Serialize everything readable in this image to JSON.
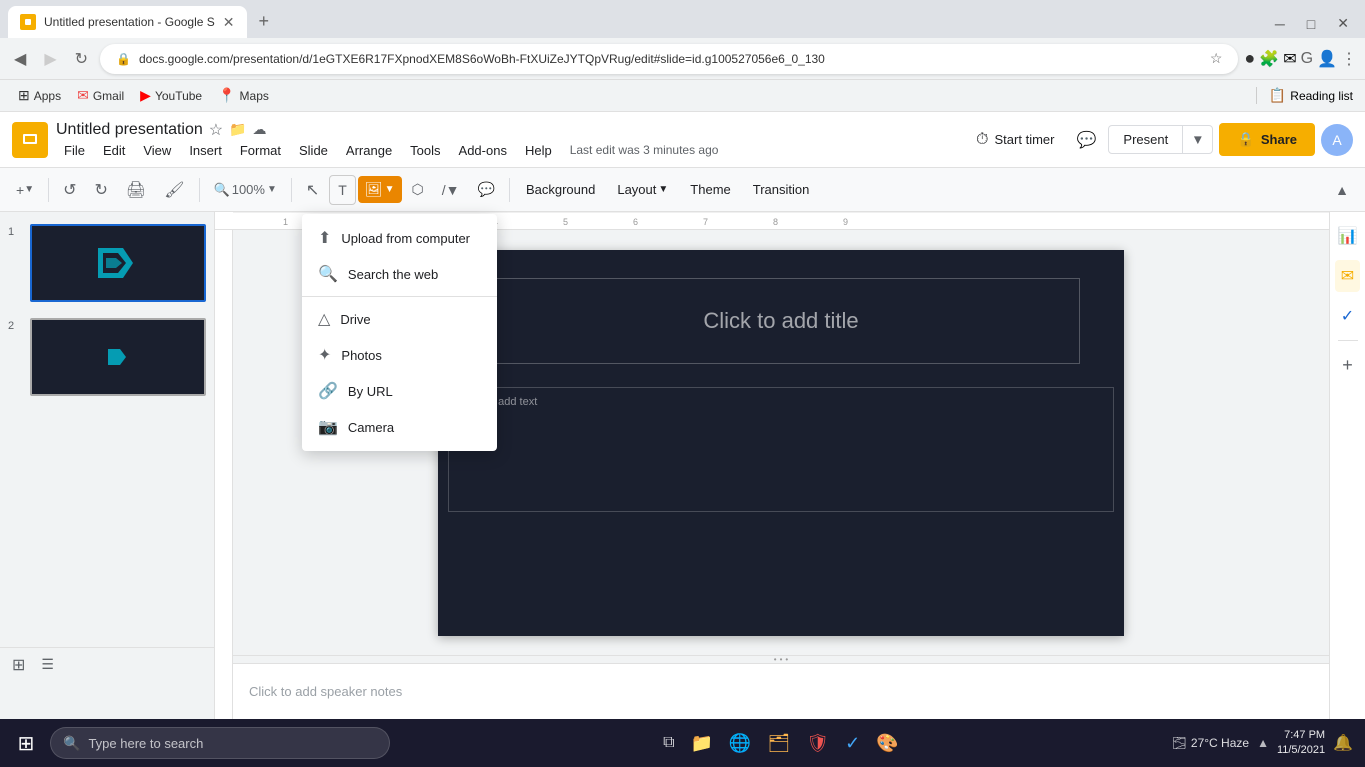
{
  "browser": {
    "tab_title": "Untitled presentation - Google S",
    "tab_favicon": "G",
    "address": "docs.google.com/presentation/d/1eGTXE6R17FXpnodXEM8S6oWoBh-FtXUiZeJYTQpVRug/edit#slide=id.g100527056e6_0_130",
    "new_tab_label": "+",
    "bookmarks": [
      {
        "label": "Apps",
        "icon": "grid"
      },
      {
        "label": "Gmail",
        "icon": "mail"
      },
      {
        "label": "YouTube",
        "icon": "youtube"
      },
      {
        "label": "Maps",
        "icon": "map"
      }
    ],
    "reading_list": "Reading list"
  },
  "app": {
    "logo_color": "#f6ae00",
    "title": "Untitled presentation",
    "star_icon": "★",
    "folder_icon": "📁",
    "cloud_icon": "☁",
    "menu": [
      "File",
      "Edit",
      "View",
      "Insert",
      "Format",
      "Slide",
      "Arrange",
      "Tools",
      "Add-ons",
      "Help"
    ],
    "last_edit": "Last edit was 3 minutes ago",
    "start_timer": "Start timer",
    "comment_icon": "💬",
    "present_btn": "Present",
    "share_btn": "Share"
  },
  "toolbar": {
    "undo_label": "↺",
    "redo_label": "↻",
    "print_label": "🖨",
    "paint_label": "🖌",
    "zoom_label": "100%",
    "cursor_label": "↖",
    "background_btn": "Background",
    "layout_btn": "Layout",
    "theme_btn": "Theme",
    "transition_btn": "Transition"
  },
  "image_menu": {
    "upload_label": "Upload from computer",
    "search_label": "Search the web",
    "drive_label": "Drive",
    "photos_label": "Photos",
    "by_url_label": "By URL",
    "camera_label": "Camera"
  },
  "slide": {
    "title_placeholder": "Click to add title",
    "text_placeholder": "Click to add text",
    "notes_placeholder": "Click to add speaker notes"
  },
  "taskbar": {
    "search_placeholder": "Type here to search",
    "clock": "7:47 PM",
    "date": "11/5/2021",
    "weather": "27°C Haze",
    "start_icon": "⊞"
  }
}
